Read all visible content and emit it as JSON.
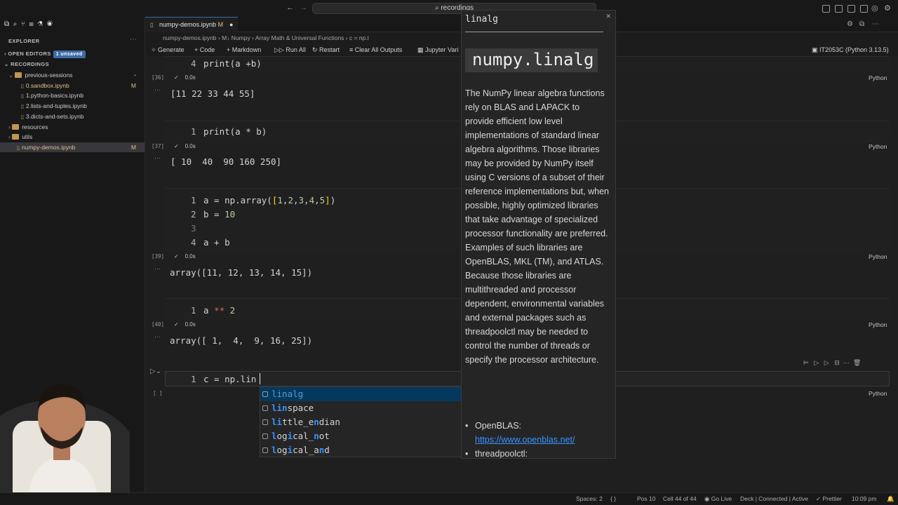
{
  "window": {
    "search_text": "recordings"
  },
  "sidebar": {
    "title": "EXPLORER",
    "open_editors": "OPEN EDITORS",
    "unsaved_badge": "1 unsaved",
    "section": "RECORDINGS",
    "items": [
      {
        "label": "previous-sessions",
        "type": "folder"
      },
      {
        "label": "0.sandbox.ipynb",
        "badge": "M"
      },
      {
        "label": "1.python-basics.ipynb"
      },
      {
        "label": "2.lists-and-tuples.ipynb"
      },
      {
        "label": "3.dicts-and-sets.ipynb"
      },
      {
        "label": "resources",
        "type": "folder"
      },
      {
        "label": "utils",
        "type": "folder"
      },
      {
        "label": "numpy-demos.ipynb",
        "badge": "M"
      }
    ]
  },
  "tab": {
    "label": "numpy-demos.ipynb",
    "badge": "M"
  },
  "breadcrumb": {
    "file": "numpy-demos.ipynb",
    "md": "M↓ Numpy",
    "section": "Array Math & Universal Functions",
    "cell": "c = np.l"
  },
  "toolbar": {
    "generate": "Generate",
    "code": "Code",
    "markdown": "Markdown",
    "run_all": "Run All",
    "restart": "Restart",
    "clear": "Clear All Outputs",
    "jupyter": "Jupyter Vari",
    "kernel": "IT2053C (Python 3.13.5)"
  },
  "cells": [
    {
      "exec": "[36]",
      "time": "0.0s",
      "lang": "Python",
      "output": "[11 22 33 44 55]"
    },
    {
      "exec": "[37]",
      "time": "0.0s",
      "lang": "Python",
      "output": "[ 10  40  90 160 250]"
    },
    {
      "exec": "[39]",
      "time": "0.0s",
      "lang": "Python",
      "output": "array([11, 12, 13, 14, 15])"
    },
    {
      "exec": "[40]",
      "time": "0.0s",
      "lang": "Python",
      "output": "array([ 1,  4,  9, 16, 25])"
    },
    {
      "exec": "[ ]",
      "time": "",
      "lang": "Python",
      "output": ""
    }
  ],
  "code": {
    "c0": {
      "ln": "4",
      "text": "print(a +b)"
    },
    "c1": {
      "ln": "1",
      "text": "print(a * b)"
    },
    "c2": [
      {
        "ln": "1",
        "text": "a = np.array([1,2,3,4,5])"
      },
      {
        "ln": "2",
        "text": "b = 10"
      },
      {
        "ln": "3",
        "text": ""
      },
      {
        "ln": "4",
        "text": "a + b"
      }
    ],
    "c3": {
      "ln": "1",
      "text": "a ** 2"
    },
    "c4": {
      "ln": "1",
      "text": "c = np.lin"
    }
  },
  "suggest": [
    {
      "label": "linalg",
      "hl": "lin",
      "rest": "alg"
    },
    {
      "label": "linspace",
      "hl": "lin",
      "rest": "space"
    },
    {
      "label": "little_endian"
    },
    {
      "label": "logical_not"
    },
    {
      "label": "logical_and"
    }
  ],
  "doc": {
    "title": "linalg",
    "code": "numpy.linalg",
    "body": "The NumPy linear algebra functions rely on BLAS and LAPACK to provide efficient low level implementations of standard linear algebra algorithms. Those libraries may be provided by NumPy itself using C versions of a subset of their reference implementations but, when possible, highly optimized libraries that take advantage of specialized processor functionality are preferred. Examples of such libraries are OpenBLAS, MKL (TM), and ATLAS. Because those libraries are multithreaded and processor dependent, environmental variables and external packages such as threadpoolctl may be needed to control the number of threads or specify the processor architecture.",
    "list": [
      {
        "label": "OpenBLAS:",
        "link": "https://www.openblas.net/"
      },
      {
        "label": "threadpoolctl:"
      }
    ]
  },
  "statusbar": {
    "spaces": "Spaces: 2",
    "braces": "{ }",
    "pos": "Pos 10",
    "cell": "Cell 44 of 44",
    "golive": "Go Live",
    "deck": "Deck | Connected | Active",
    "prettier": "Prettier",
    "time": "10:09 pm"
  },
  "colors": {
    "accent": "#3794ff",
    "link": "#3794ff",
    "selection": "#04395e"
  }
}
